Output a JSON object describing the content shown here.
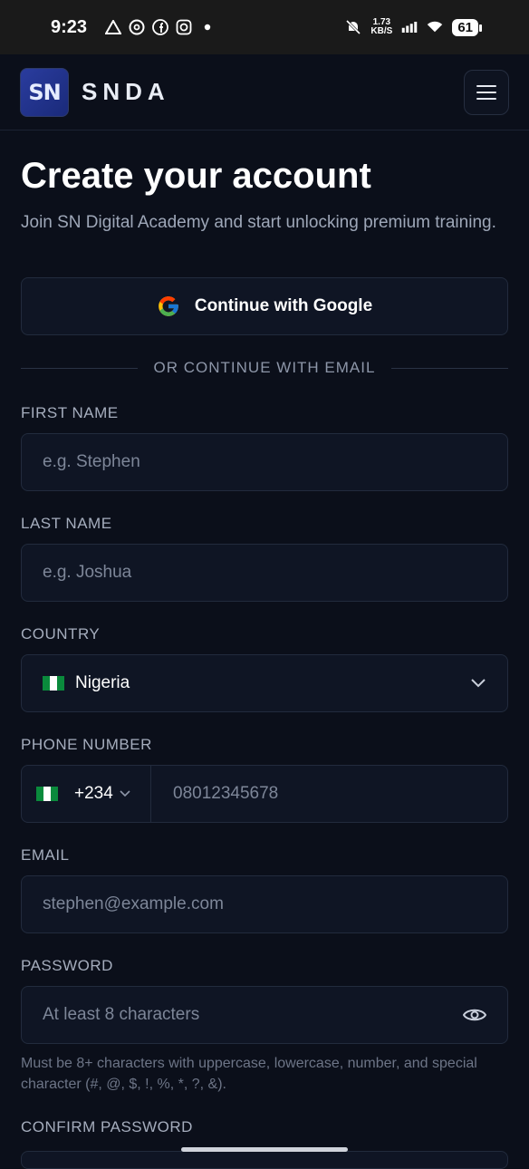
{
  "status_bar": {
    "time": "9:23",
    "net_speed_value": "1.73",
    "net_speed_unit": "KB/S",
    "battery": "61"
  },
  "header": {
    "logo_text": "SN",
    "brand": "SNDA"
  },
  "page": {
    "title": "Create your account",
    "subtitle": "Join SN Digital Academy and start unlocking premium training."
  },
  "google": {
    "label": "Continue with Google"
  },
  "divider": {
    "label": "OR CONTINUE WITH EMAIL"
  },
  "form": {
    "first_name": {
      "label": "FIRST NAME",
      "placeholder": "e.g. Stephen"
    },
    "last_name": {
      "label": "LAST NAME",
      "placeholder": "e.g. Joshua"
    },
    "country": {
      "label": "COUNTRY",
      "value": "Nigeria"
    },
    "phone": {
      "label": "PHONE NUMBER",
      "code": "+234",
      "placeholder": "08012345678"
    },
    "email": {
      "label": "EMAIL",
      "placeholder": "stephen@example.com"
    },
    "password": {
      "label": "PASSWORD",
      "placeholder": "At least 8 characters",
      "hint": "Must be 8+ characters with uppercase, lowercase, number, and special character (#, @, $, !, %, *, ?, &)."
    },
    "confirm_password": {
      "label": "CONFIRM PASSWORD"
    }
  },
  "colors": {
    "background": "#0b0f1a",
    "field_bg": "#0f1524",
    "border": "#222b3d",
    "muted_text": "#9ea7b8"
  }
}
